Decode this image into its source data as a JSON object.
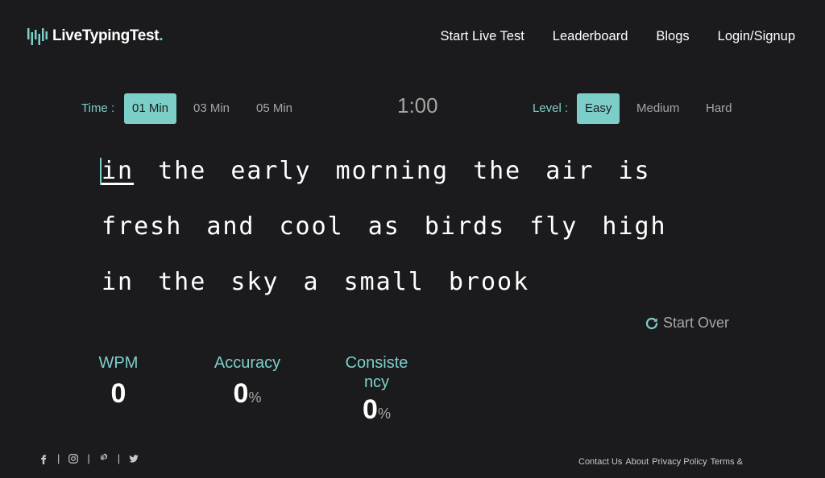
{
  "header": {
    "logo_text": "LiveTypingTest",
    "logo_dot": ".",
    "nav": [
      "Start Live Test",
      "Leaderboard",
      "Blogs",
      "Login/Signup"
    ]
  },
  "controls": {
    "time_label": "Time :",
    "time_options": [
      "01 Min",
      "03 Min",
      "05 Min"
    ],
    "time_selected": "01 Min",
    "timer": "1:00",
    "level_label": "Level :",
    "level_options": [
      "Easy",
      "Medium",
      "Hard"
    ],
    "level_selected": "Easy"
  },
  "typing": {
    "lines": [
      [
        "in",
        "the",
        "early",
        "morning",
        "the",
        "air",
        "is"
      ],
      [
        "fresh",
        "and",
        "cool",
        "as",
        "birds",
        "fly",
        "high"
      ],
      [
        "in",
        "the",
        "sky",
        "a",
        "small",
        "brook"
      ]
    ],
    "current_word": "in"
  },
  "start_over_label": "Start Over",
  "stats": {
    "wpm": {
      "label": "WPM",
      "value": "0"
    },
    "accuracy": {
      "label": "Accuracy",
      "value": "0",
      "unit": "%"
    },
    "consistency": {
      "label_line1": "Consiste",
      "label_line2": "ncy",
      "value": "0",
      "unit": "%"
    }
  },
  "footer": {
    "social_icons": [
      "facebook-icon",
      "instagram-icon",
      "pinterest-icon",
      "twitter-icon"
    ],
    "separator": "|",
    "links": [
      "Contact Us",
      "About",
      "Privacy Policy",
      "Terms &"
    ]
  },
  "colors": {
    "background": "#1b1b1e",
    "accent": "#7ccfc9",
    "muted": "#a6a6a6",
    "text": "#ffffff"
  }
}
